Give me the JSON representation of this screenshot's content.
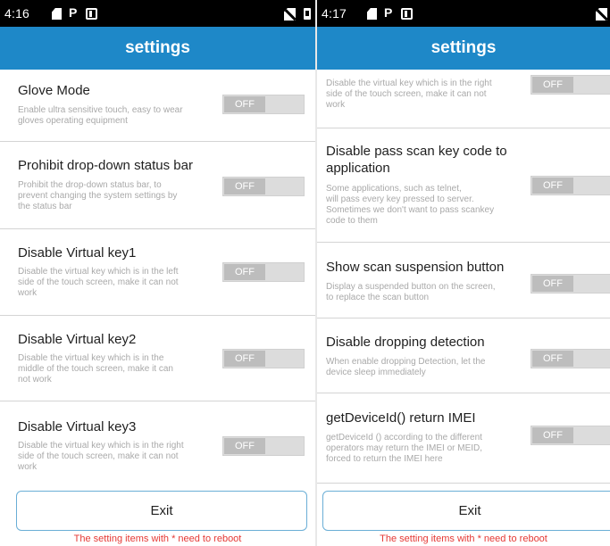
{
  "left": {
    "status": {
      "time": "4:16"
    },
    "title": "settings",
    "items": [
      {
        "title": "Glove Mode",
        "desc": "Enable ultra sensitive touch, easy to wear\ngloves operating equipment",
        "toggle": "OFF"
      },
      {
        "title": "Prohibit drop-down status bar",
        "desc": "Prohibit the drop-down status bar, to\nprevent changing the system settings by\nthe status bar",
        "toggle": "OFF"
      },
      {
        "title": "Disable Virtual key1",
        "desc": "Disable the virtual key which is in the left\nside of the touch screen, make it can not\nwork",
        "toggle": "OFF"
      },
      {
        "title": "Disable Virtual key2",
        "desc": "Disable the virtual key which is in the\nmiddle of the touch screen, make it can\nnot work",
        "toggle": "OFF"
      },
      {
        "title": "Disable Virtual key3",
        "desc": "Disable the virtual key which is in the right\nside of the touch screen, make it can not\nwork",
        "toggle": "OFF"
      }
    ],
    "exit_label": "Exit",
    "note": "The setting items with * need to reboot"
  },
  "right": {
    "status": {
      "time": "4:17"
    },
    "title": "settings",
    "items": [
      {
        "title": "",
        "desc": "Disable the virtual key which is in the right\nside of the touch screen, make it can not\nwork",
        "toggle": "OFF"
      },
      {
        "title": "Disable pass scan key code to\napplication",
        "desc": "Some applications, such as telnet,\nwill pass every key pressed to server.\nSometimes we don't want to pass scankey\ncode to them",
        "toggle": "OFF"
      },
      {
        "title": "Show scan suspension button",
        "desc": "Display a suspended button on the screen,\nto replace the scan button",
        "toggle": "OFF"
      },
      {
        "title": "Disable dropping detection",
        "desc": "When enable dropping Detection, let the\ndevice sleep immediately",
        "toggle": "OFF"
      },
      {
        "title": "getDeviceId() return IMEI",
        "desc": "getDeviceId () according to the different\noperators may return the IMEI or MEID,\nforced to return the IMEI here",
        "toggle": "OFF"
      }
    ],
    "exit_label": "Exit",
    "note": "The setting items with * need to reboot"
  },
  "colors": {
    "title_bar": "#1e88c8",
    "toggle_off": "#bdbdbd",
    "note": "#e53935",
    "exit_border": "#6aaed6"
  },
  "icons": [
    "sim-card-icon",
    "p-notification-icon",
    "screen-icon",
    "no-sim-icon",
    "battery-icon"
  ]
}
